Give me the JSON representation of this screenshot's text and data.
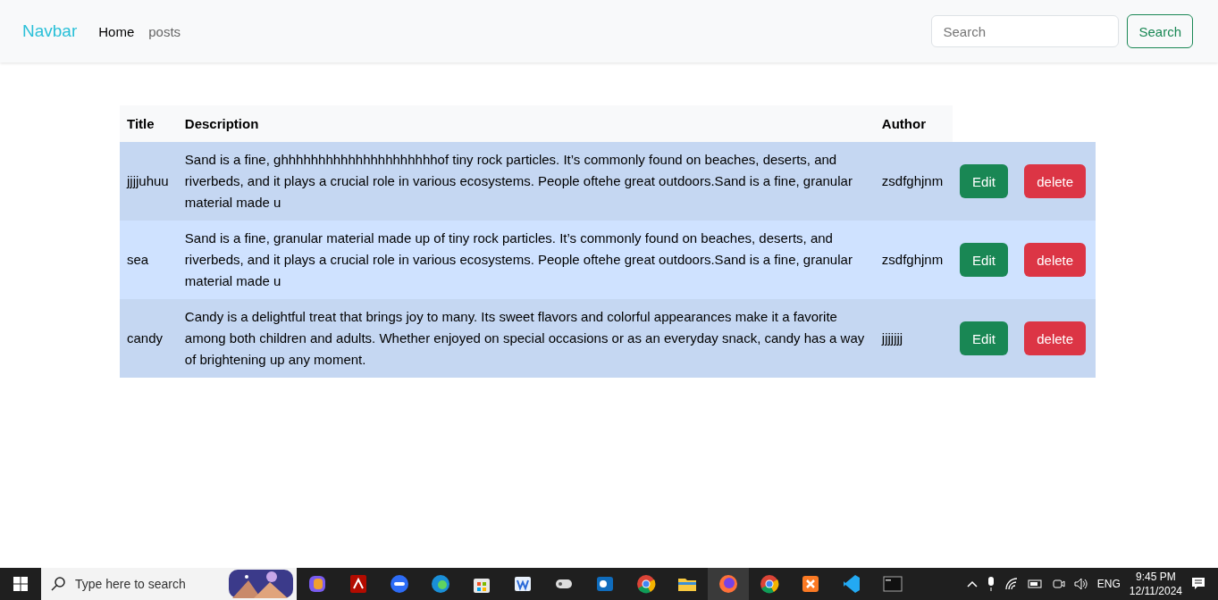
{
  "navbar": {
    "brand": "Navbar",
    "links": [
      {
        "label": "Home",
        "selected": true
      },
      {
        "label": "posts",
        "selected": false
      }
    ],
    "search": {
      "placeholder": "Search"
    },
    "search_button": "Search"
  },
  "table": {
    "columns": [
      "Title",
      "Description",
      "Author"
    ],
    "rows": [
      {
        "title": "jjjjuhuu",
        "description": "Sand is a fine, ghhhhhhhhhhhhhhhhhhhhhof tiny rock particles. It’s commonly found on beaches, deserts, and riverbeds, and it plays a crucial role in various ecosystems. People oftehe great outdoors.Sand is a fine, granular material made u",
        "author": "zsdfghjnm",
        "edit": "Edit",
        "delete": "delete"
      },
      {
        "title": "sea",
        "description": "Sand is a fine, granular material made up of tiny rock particles. It’s commonly found on beaches, deserts, and riverbeds, and it plays a crucial role in various ecosystems. People oftehe great outdoors.Sand is a fine, granular material made u",
        "author": "zsdfghjnm",
        "edit": "Edit",
        "delete": "delete"
      },
      {
        "title": "candy",
        "description": "Candy is a delightful treat that brings joy to many. Its sweet flavors and colorful appearances make it a favorite among both children and adults. Whether enjoyed on special occasions or as an everyday snack, candy has a way of brightening up any moment.",
        "author": "jjjjjjj",
        "edit": "Edit",
        "delete": "delete"
      }
    ]
  },
  "taskbar": {
    "search": {
      "placeholder": "Type here to search"
    },
    "apps": [
      {
        "kind": "copilot",
        "selected": false
      },
      {
        "kind": "pdf",
        "selected": false
      },
      {
        "kind": "zoom",
        "selected": false
      },
      {
        "kind": "edge",
        "selected": false
      },
      {
        "kind": "store",
        "selected": false
      },
      {
        "kind": "word",
        "selected": false
      },
      {
        "kind": "game",
        "selected": false
      },
      {
        "kind": "outlook",
        "selected": false
      },
      {
        "kind": "chrome",
        "selected": false
      },
      {
        "kind": "folder",
        "selected": false
      },
      {
        "kind": "firefox",
        "selected": true
      },
      {
        "kind": "chrome",
        "selected": false
      },
      {
        "kind": "xampp",
        "selected": false
      },
      {
        "kind": "vscode",
        "selected": false
      },
      {
        "kind": "terminal",
        "selected": false
      }
    ],
    "language": "ENG",
    "time": "9:45 PM",
    "date": "12/11/2024"
  }
}
